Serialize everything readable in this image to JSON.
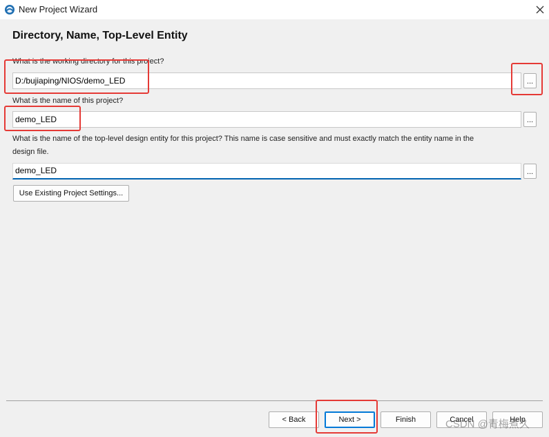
{
  "window": {
    "title": "New Project Wizard",
    "app_icon": "wizard-app-icon",
    "close_icon": "close-icon"
  },
  "page": {
    "heading": "Directory, Name, Top-Level Entity"
  },
  "fields": {
    "working_directory": {
      "label": "What is the working directory for this project?",
      "value": "D:/bujiaping/NIOS/demo_LED",
      "browse_label": "..."
    },
    "project_name": {
      "label": "What is the name of this project?",
      "value": "demo_LED",
      "browse_label": "..."
    },
    "top_level_entity": {
      "label_line1": "What is the name of the top-level design entity for this project? This name is case sensitive and must exactly match the entity name in the",
      "label_line2": "design file.",
      "value": "demo_LED",
      "browse_label": "..."
    }
  },
  "buttons": {
    "use_existing": "Use Existing Project Settings...",
    "back": "< Back",
    "next": "Next >",
    "finish": "Finish",
    "cancel": "Cancel",
    "help": "Help"
  },
  "watermark": "CSDN @青梅煮久",
  "colors": {
    "annotation": "#e53935",
    "focus_underline": "#0063b1",
    "default_button_border": "#0078d7"
  }
}
